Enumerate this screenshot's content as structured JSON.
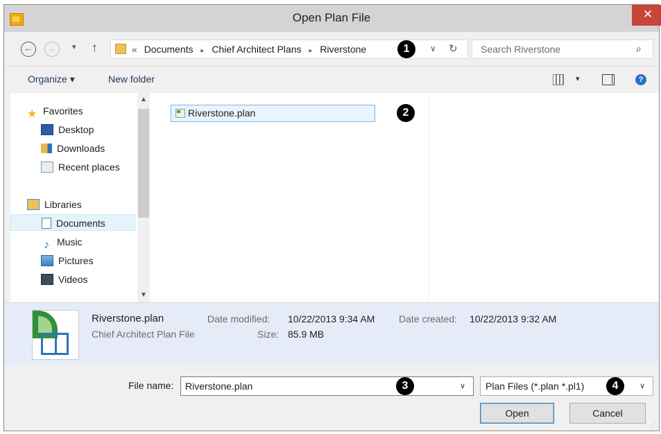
{
  "window": {
    "title": "Open Plan File",
    "close": "✕"
  },
  "nav": {
    "back": "←",
    "forward": "→",
    "recent": "▾",
    "up": "↑",
    "breadcrumb_prefix": "«",
    "breadcrumb": [
      "Documents",
      "Chief Architect Plans",
      "Riverstone"
    ],
    "crumb_sep": "▸",
    "address_dropdown": "∨",
    "refresh": "↻",
    "search_placeholder": "Search Riverstone",
    "search_icon": "⌕"
  },
  "toolbar": {
    "organize": "Organize ▾",
    "new_folder": "New folder",
    "view_dropdown": "▾",
    "help": "?"
  },
  "sidebar": {
    "favorites_header": "Favorites",
    "favorites": [
      "Desktop",
      "Downloads",
      "Recent places"
    ],
    "libraries_header": "Libraries",
    "libraries": [
      "Documents",
      "Music",
      "Pictures",
      "Videos"
    ],
    "selected": "Documents",
    "scroll_up": "▲",
    "scroll_down": "▼"
  },
  "files": [
    {
      "name": "Riverstone.plan",
      "selected": true
    }
  ],
  "details": {
    "name": "Riverstone.plan",
    "type": "Chief Architect Plan File",
    "date_modified_label": "Date modified:",
    "date_modified": "10/22/2013 9:34 AM",
    "date_created_label": "Date created:",
    "date_created": "10/22/2013 9:32 AM",
    "size_label": "Size:",
    "size": "85.9 MB"
  },
  "bottom": {
    "file_name_label": "File name:",
    "file_name": "Riverstone.plan",
    "filter": "Plan Files (*.plan *.pl1)",
    "dropdown": "∨",
    "open": "Open",
    "cancel": "Cancel",
    "grip": "⋰"
  },
  "callouts": [
    "1",
    "2",
    "3",
    "4"
  ],
  "colors": {
    "accent": "#3c7fb1",
    "close": "#c7453b",
    "details_bg": "#e6ecf7",
    "callout": "#000000"
  },
  "icons": [
    "app-icon",
    "back-icon",
    "forward-icon",
    "up-icon",
    "folder-icon",
    "refresh-icon",
    "search-icon",
    "view-icon",
    "preview-pane-icon",
    "help-icon",
    "star-icon",
    "desktop-icon",
    "downloads-icon",
    "recent-places-icon",
    "libraries-icon",
    "documents-icon",
    "music-icon",
    "pictures-icon",
    "videos-icon",
    "plan-file-icon"
  ]
}
